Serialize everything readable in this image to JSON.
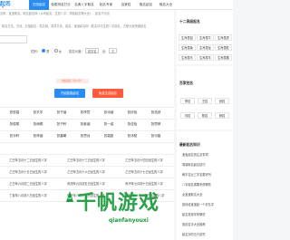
{
  "header": {
    "logo": "起名",
    "logo_sub": "网",
    "nav": [
      {
        "label": "在线起名",
        "active": true
      },
      {
        "label": "免费测名打分",
        "active": false
      },
      {
        "label": "名典八字取名",
        "active": false
      },
      {
        "label": "起名专家",
        "active": false
      },
      {
        "label": "百家姓",
        "active": false
      },
      {
        "label": "取名起名",
        "active": false
      },
      {
        "label": "取名大全",
        "active": false
      }
    ]
  },
  "notice": "名称、宝宝取名，取名起名网（公司起名、生辰八字、周易起名等大全），起名不为名",
  "desc": "取名方法，古诗、五福起名，姓名网，易学文化，起名、宝宝起名网（姓名评分生辰八字起名，方便大家快速起名",
  "form": {
    "gender_label": "性别：",
    "male": "男",
    "female": "女",
    "birth_label": "姓名长度：",
    "birth_value": "双字名",
    "birth_label2": "出：",
    "birth_value2": "王",
    "note": "姓名起名（合八字）"
  },
  "buttons": {
    "start": "开始智能起名",
    "free": "免费生成起名"
  },
  "single_names": [
    [
      "张哲嘉",
      "张天宇",
      "张子涵",
      "张梓萱",
      "张诗涵",
      "张欣怡",
      "张浩然"
    ],
    [
      "张俊熙",
      "张雨桐",
      "张子轩",
      "张紫涵",
      "张一诺",
      "张佳怡",
      "张思琪"
    ],
    [
      "张宇轩",
      "张梓涵",
      "张晨曦",
      "张思远",
      "张嘉懿",
      "张沐阳",
      "张可馨"
    ]
  ],
  "combo_names": [
    [
      "乙巳年五月十二日出生的八字",
      "乙巳年五月十三日出生的八字",
      "乙巳年五月十四日出生的八字"
    ],
    [
      "乙巳年五月十五日出生的八字",
      "乙巳年五月十六日出生的八字",
      "乙巳年五月十七日出生的八字"
    ],
    [
      "乙巳年六月初二日出生的八字",
      "丙戌年九月初五日出生的八字",
      "丙子年七月初十日出生的八字"
    ],
    [
      "丁亥年八月初八日出生的八字",
      "甲午年八月十六日出生的八字",
      "丁巳年十一月十四日出生的八字"
    ]
  ],
  "sidebar": {
    "box1_title": "十二高级起名",
    "box1_chips": [
      "生肖属鼠",
      "生肖属牛",
      "生肖属虎",
      "生肖属兔",
      "生肖属龙",
      "生肖属蛇",
      "生肖属马",
      "生肖属羊",
      "生肖属猴"
    ],
    "box2_title": "百家姓名",
    "box2_chips": [
      "李姓",
      "王姓",
      "张姓",
      "刘姓",
      "陈姓",
      "杨姓"
    ],
    "box3_title": "最新起名知识",
    "articles": [
      "宝宝起名的注意事项",
      "周易取名起名技巧",
      "两字名比三字名更好吗",
      "八字起名需要考虑哪些",
      "女宝宝取名大全",
      "如何给宝宝起一个好名字",
      "起名常用字有哪些",
      "男孩名字大全推荐",
      "起名字的五行讲究"
    ]
  },
  "watermark": {
    "text": "千帆游戏",
    "sub": "qianfanyouxi"
  },
  "colors": {
    "accent": "#2a8cf0",
    "red": "#ff5a3c",
    "watermark": "#1a9a3a"
  }
}
